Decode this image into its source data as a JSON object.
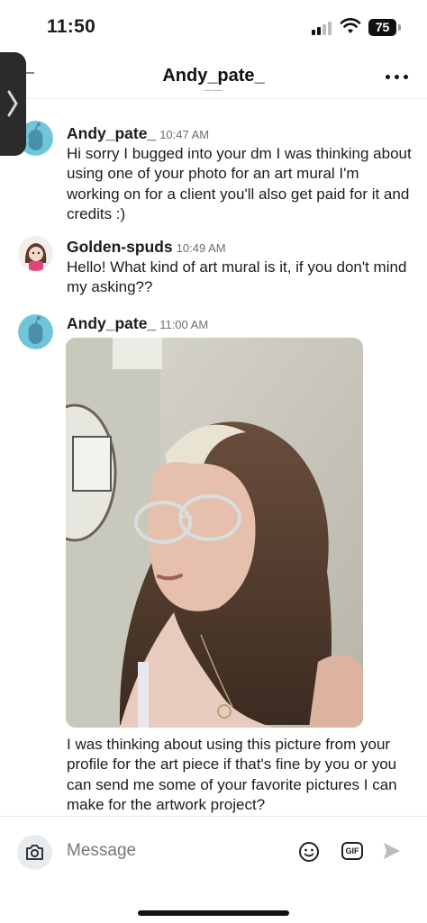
{
  "status_bar": {
    "time": "11:50",
    "battery": "75"
  },
  "header": {
    "title": "Andy_pate_",
    "more_icon": "more-horizontal-icon"
  },
  "messages": [
    {
      "author": "Andy_pate_",
      "time": "10:47 AM",
      "text": "Hi sorry I bugged into your dm I was thinking about using one of your photo for an art mural I'm working on for a client you'll also get paid for it and credits :)"
    },
    {
      "author": "Golden-spuds",
      "time": "10:49 AM",
      "text": "Hello! What kind of art mural is it, if you don't mind my asking??"
    },
    {
      "author": "Andy_pate_",
      "time": "11:00 AM",
      "text": "I was thinking about using this picture from your profile for the art piece if that's fine by you or you can send me some of your favorite pictures I can make for the artwork project?"
    }
  ],
  "composer": {
    "placeholder": "Message",
    "gif_label": "GIF"
  },
  "colors": {
    "snoo_avatar_bg": "#6fc6d9",
    "camera_button_bg": "#e9ecee",
    "send_disabled": "#b9bdc0"
  }
}
